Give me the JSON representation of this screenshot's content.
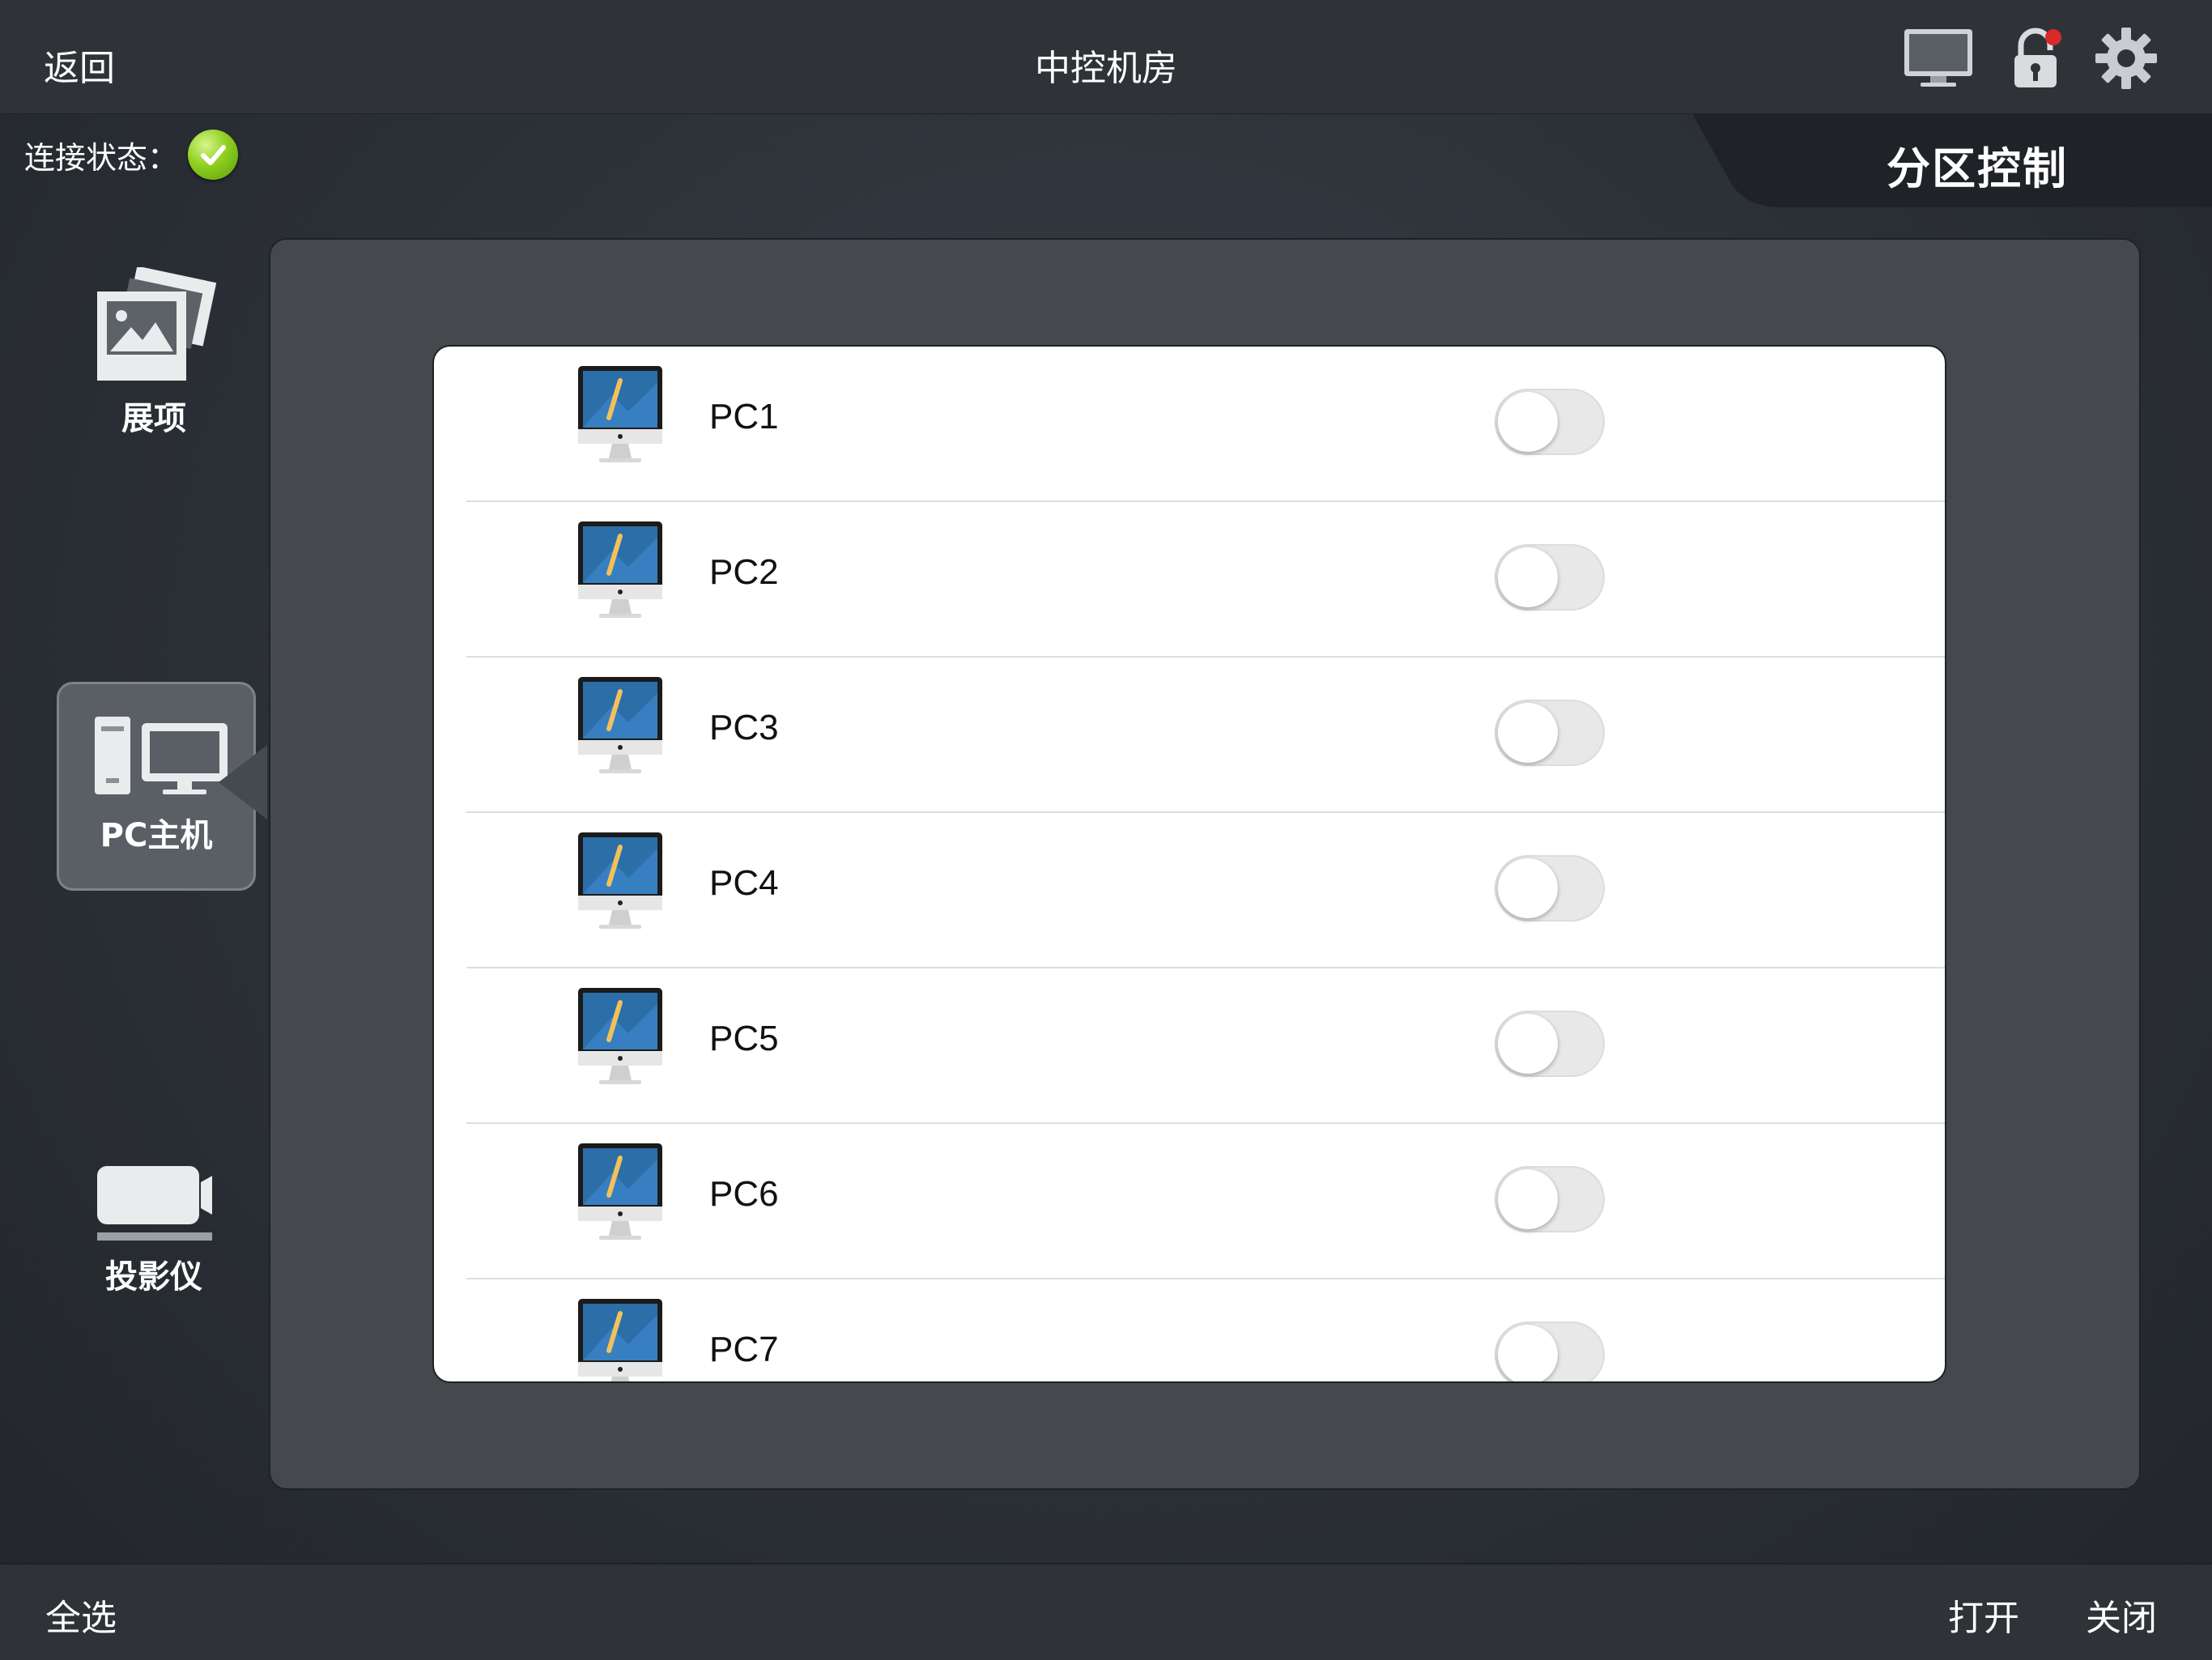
{
  "header": {
    "back_label": "返回",
    "title": "中控机房",
    "icons": [
      "monitor-icon",
      "lock-icon",
      "gear-icon"
    ]
  },
  "status": {
    "label": "连接状态：",
    "state_icon": "check-icon",
    "state_color": "#8fcf1f"
  },
  "section_tab": {
    "label": "分区控制"
  },
  "nav": {
    "items": [
      {
        "label": "展项",
        "icon": "photos-icon",
        "active": false
      },
      {
        "label": "PC主机",
        "icon": "pc-icon",
        "active": true
      },
      {
        "label": "投影仪",
        "icon": "projector-icon",
        "active": false
      }
    ]
  },
  "devices": [
    {
      "name": "PC1",
      "on": false
    },
    {
      "name": "PC2",
      "on": false
    },
    {
      "name": "PC3",
      "on": false
    },
    {
      "name": "PC4",
      "on": false
    },
    {
      "name": "PC5",
      "on": false
    },
    {
      "name": "PC6",
      "on": false
    },
    {
      "name": "PC7",
      "on": false
    }
  ],
  "footer": {
    "select_all": "全选",
    "open": "打开",
    "close": "关闭"
  }
}
